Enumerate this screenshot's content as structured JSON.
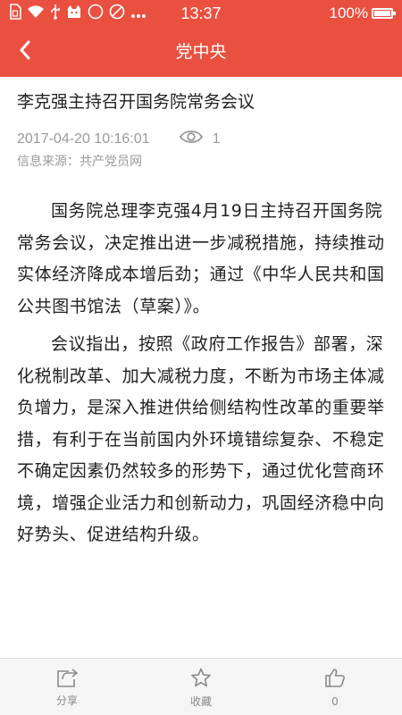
{
  "status_bar": {
    "time": "13:37",
    "battery_text": "100%",
    "battery_level": 1.0,
    "icons": [
      "sim-card-icon",
      "wifi-icon",
      "usb-icon",
      "cat-app-icon",
      "notification-icon",
      "mute-icon",
      "more-dots-icon"
    ]
  },
  "app_bar": {
    "title": "党中央",
    "back_icon": "chevron-left-icon"
  },
  "article": {
    "title": "李克强主持召开国务院常务会议",
    "date": "2017-04-20 10:16:01",
    "view_icon": "eye-icon",
    "views": "1",
    "source": "信息来源：共产党员网",
    "paragraphs": [
      "国务院总理李克强4月19日主持召开国务院常务会议，决定推出进一步减税措施，持续推动实体经济降成本增后劲；通过《中华人民共和国公共图书馆法（草案）》。",
      "会议指出，按照《政府工作报告》部署，深化税制改革、加大减税力度，不断为市场主体减负增力，是深入推进供给侧结构性改革的重要举措，有利于在当前国内外环境错综复杂、不稳定不确定因素仍然较多的形势下，通过优化营商环境，增强企业活力和创新动力，巩固经济稳中向好势头、促进结构升级。"
    ]
  },
  "bottom_bar": {
    "share_label": "分享",
    "favorite_label": "收藏",
    "like_count": "0",
    "icon_color": "#8a8a8a"
  },
  "colors": {
    "accent": "#e9503f",
    "text": "#222222",
    "meta": "#9a9a9a"
  }
}
